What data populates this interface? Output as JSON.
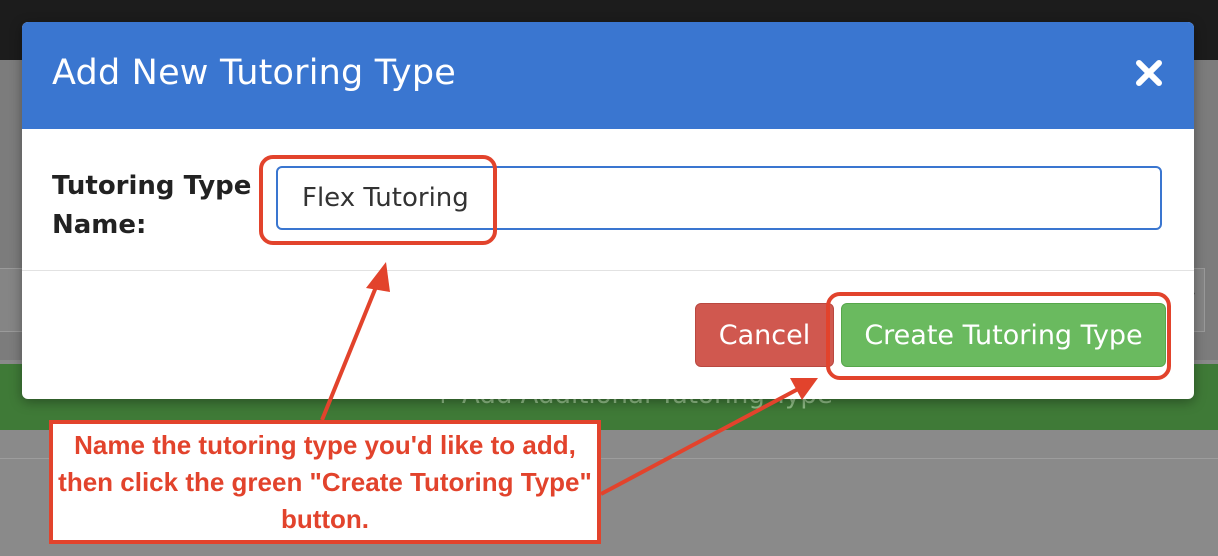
{
  "background": {
    "add_link_text": "+ Add Additional Tutoring Type"
  },
  "modal": {
    "title": "Add New Tutoring Type",
    "close_icon": "close-icon",
    "field_label": "Tutoring Type Name:",
    "field_value": "Flex Tutoring",
    "cancel_label": "Cancel",
    "create_label": "Create Tutoring Type"
  },
  "callout": {
    "text": "Name the tutoring type you'd like to add, then click the green \"Create Tutoring Type\" button."
  },
  "colors": {
    "header": "#3a76d0",
    "cancel": "#d0584f",
    "create": "#6aba5f",
    "annotation": "#e2432c"
  }
}
